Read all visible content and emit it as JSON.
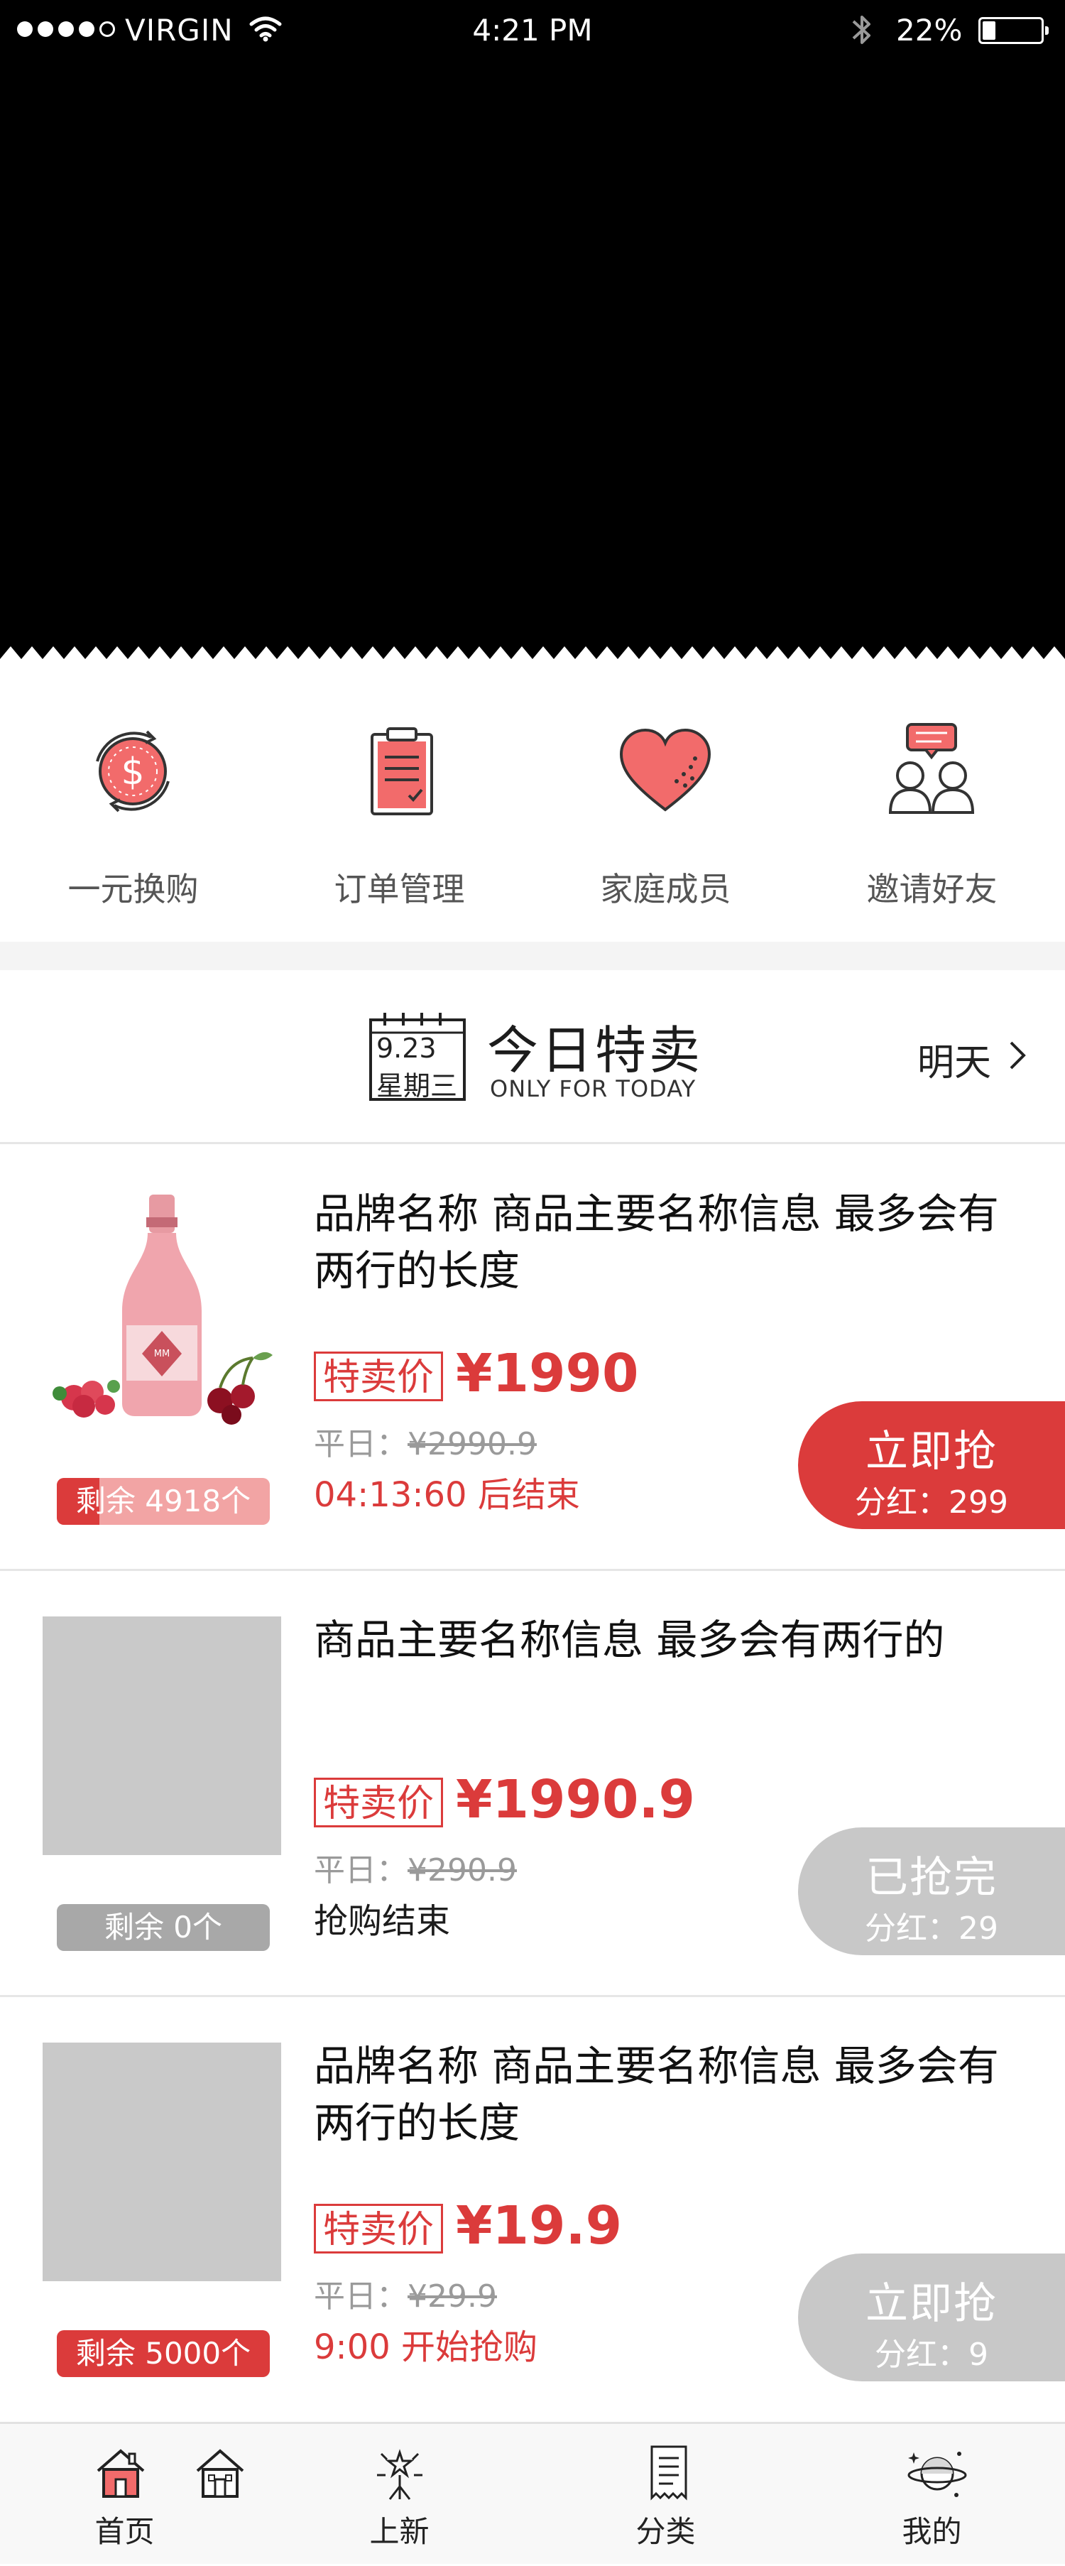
{
  "status_bar": {
    "carrier": "VIRGIN",
    "time": "4:21 PM",
    "battery": "22%",
    "battery_level": 0.22,
    "icons": [
      "signal-dots",
      "wifi-icon",
      "bluetooth-icon",
      "battery-icon"
    ]
  },
  "quick_entries": [
    {
      "label": "一元换购",
      "icon": "dollar-exchange-icon"
    },
    {
      "label": "订单管理",
      "icon": "clipboard-icon"
    },
    {
      "label": "家庭成员",
      "icon": "heart-icon"
    },
    {
      "label": "邀请好友",
      "icon": "invite-friends-icon"
    }
  ],
  "today": {
    "calendar_date": "9.23",
    "calendar_weekday": "星期三",
    "title": "今日特卖",
    "subtitle": "ONLY FOR TODAY",
    "next_label": "明天"
  },
  "products": [
    {
      "name": "品牌名称 商品主要名称信息 最多会有两行的长度",
      "badge": "特卖价",
      "price": "¥1990",
      "orig_label": "平日：",
      "orig_price": "¥2990.9",
      "note": "04:13:60 后结束",
      "stock": "剩余 4918个",
      "cta_main": "立即抢",
      "cta_sub": "分红：299",
      "image": "sparkling-wine-with-berries"
    },
    {
      "name": "商品主要名称信息 最多会有两行的",
      "badge": "特卖价",
      "price": "¥1990.9",
      "orig_label": "平日：",
      "orig_price": "¥290.9",
      "note": "抢购结束",
      "stock": "剩余 0个",
      "cta_main": "已抢完",
      "cta_sub": "分红：29"
    },
    {
      "name": "品牌名称 商品主要名称信息 最多会有两行的长度",
      "badge": "特卖价",
      "price": "¥19.9",
      "orig_label": "平日：",
      "orig_price": "¥29.9",
      "note": "9:00 开始抢购",
      "stock": "剩余 5000个",
      "cta_main": "立即抢",
      "cta_sub": "分红：9"
    }
  ],
  "tabbar": [
    {
      "label": "首页",
      "icon": "home-icon",
      "active": true
    },
    {
      "label": "上新",
      "icon": "fireworks-icon",
      "active": false
    },
    {
      "label": "分类",
      "icon": "list-icon",
      "active": false
    },
    {
      "label": "我的",
      "icon": "planet-icon",
      "active": false
    }
  ],
  "colors": {
    "accent": "#db3b3b",
    "muted": "#c8c8c8",
    "text": "#1c1c1c",
    "band": "#f4f4f4"
  }
}
